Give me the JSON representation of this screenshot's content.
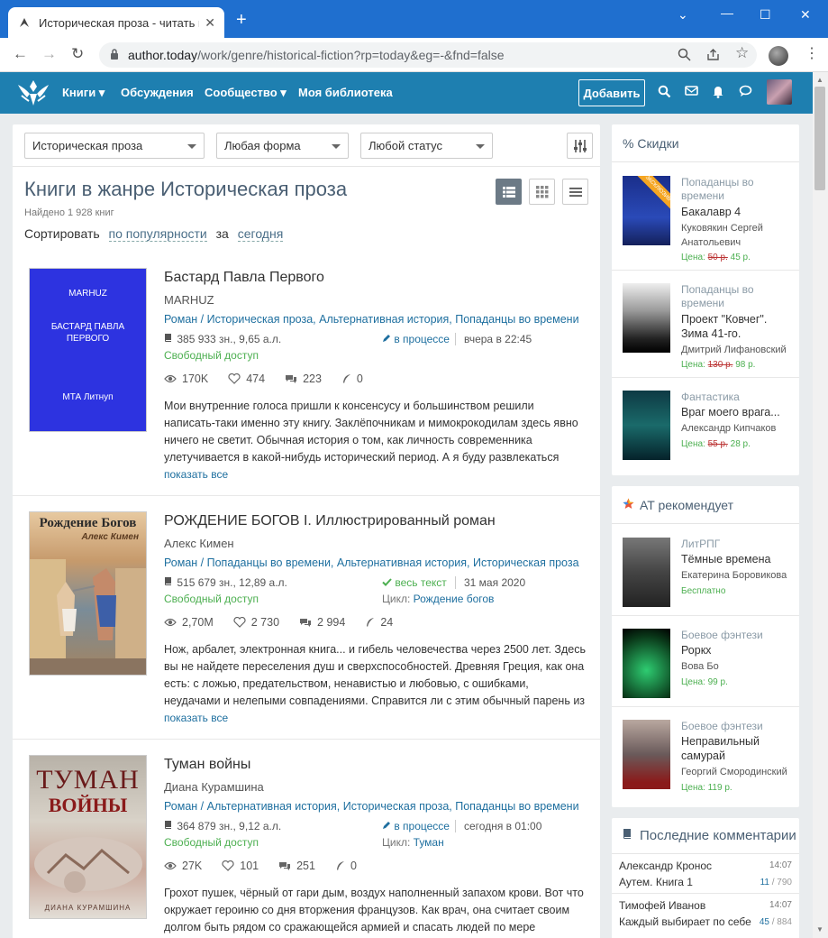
{
  "browser": {
    "tab_title": "Историческая проза - читать книг",
    "url_host": "author.today",
    "url_path": "/work/genre/historical-fiction?rp=today&eg=-&fnd=false"
  },
  "header": {
    "nav": [
      "Книги",
      "Обсуждения",
      "Сообщество",
      "Моя библиотека"
    ],
    "add_button": "Добавить"
  },
  "filters": {
    "genre": "Историческая проза",
    "form": "Любая форма",
    "status": "Любой статус"
  },
  "page": {
    "title": "Книги в жанре Историческая проза",
    "found": "Найдено 1 928 книг",
    "sort_label": "Сортировать",
    "sort_value": "по популярности",
    "sort_for": "за",
    "sort_period": "сегодня"
  },
  "books": [
    {
      "title": "Бастард Павла Первого",
      "author": "MARHUZ",
      "genres": "Роман / Историческая проза, Альтернативная история, Попаданцы во времени",
      "size": "385 933 зн., 9,65 а.л.",
      "status": "в процессе",
      "date": "вчера в 22:45",
      "access": "Свободный доступ",
      "cycle_label": "",
      "cycle": "",
      "views": "170K",
      "likes": "474",
      "comments": "223",
      "rewards": "0",
      "description": "Мои внутренние голоса пришли к консенсусу и большинством решили написать-таки именно эту книгу. Заклёпочникам и мимокрокодилам здесь явно ничего не светит. Обычная история о том, как личность современника улетучивается в какой-нибудь исторический период. А я буду развлекаться",
      "more": "показать все",
      "cover_lines": [
        "MARHUZ",
        "БАСТАРД ПАВЛА ПЕРВОГО",
        "МТА Литнуп"
      ]
    },
    {
      "title": "РОЖДЕНИЕ БОГОВ I. Иллюстрированный роман",
      "author": "Алекс Кимен",
      "genres": "Роман / Попаданцы во времени, Альтернативная история, Историческая проза",
      "size": "515 679 зн., 12,89 а.л.",
      "status": "весь текст",
      "date": "31 мая 2020",
      "access": "Свободный доступ",
      "cycle_label": "Цикл:",
      "cycle": "Рождение богов",
      "views": "2,70M",
      "likes": "2 730",
      "comments": "2 994",
      "rewards": "24",
      "description": "Нож, арбалет, электронная книга... и гибель человечества через 2500 лет. Здесь вы не найдете переселения душ и сверхспособностей. Древняя Греция, как она есть: с ложью, предательством, ненавистью и любовью, с ошибками, неудачами и нелепыми совпадениями. Справится ли с этим обычный парень из",
      "more": "показать все",
      "cover_lines": [
        "Рождение Богов",
        "Алекс Кимен"
      ]
    },
    {
      "title": "Туман войны",
      "author": "Диана Курамшина",
      "genres": "Роман / Альтернативная история, Историческая проза, Попаданцы во времени",
      "size": "364 879 зн., 9,12 а.л.",
      "status": "в процессе",
      "date": "сегодня в 01:00",
      "access": "Свободный доступ",
      "cycle_label": "Цикл:",
      "cycle": "Туман",
      "views": "27K",
      "likes": "101",
      "comments": "251",
      "rewards": "0",
      "description": "Грохот пушек, чёрный от гари дым, воздух наполненный запахом крови. Вот что окружает героиню со дня вторжения французов. Как врач, она считает своим долгом быть рядом со сражающейся армией и спасать людей по мере",
      "more": "показать все",
      "cover_lines": [
        "ТУМАН",
        "ВОЙНЫ",
        "ДИАНА КУРАМШИНА"
      ]
    }
  ],
  "discounts": {
    "title": "% Скидки",
    "price_label": "Цена:",
    "items": [
      {
        "genre": "Попаданцы во времени",
        "title": "Бакалавр 4",
        "author": "Куковякин Сергей Анатольевич",
        "old_price": "50 р.",
        "new_price": "45 р.",
        "badge": "ЭКСКЛЮЗИВ"
      },
      {
        "genre": "Попаданцы во времени",
        "title": "Проект \"Ковчег\". Зима 41-го.",
        "author": "Дмитрий Лифановский",
        "old_price": "130 р.",
        "new_price": "98 р."
      },
      {
        "genre": "Фантастика",
        "title": "Враг моего врага...",
        "author": "Александр Кипчаков",
        "old_price": "55 р.",
        "new_price": "28 р."
      }
    ]
  },
  "recommend": {
    "title": "AT рекомендует",
    "price_label": "Цена:",
    "items": [
      {
        "genre": "ЛитРПГ",
        "title": "Тёмные времена",
        "author": "Екатерина Боровикова",
        "price": "Бесплатно"
      },
      {
        "genre": "Боевое фэнтези",
        "title": "Роркх",
        "author": "Вова Бо",
        "price": "99 р."
      },
      {
        "genre": "Боевое фэнтези",
        "title": "Неправильный самурай",
        "author": "Георгий Смородинский",
        "price": "119 р."
      }
    ]
  },
  "comments": {
    "title": "Последние комментарии",
    "items": [
      {
        "user": "Александр Кронос",
        "time": "14:07",
        "book": "Аутем. Книга 1",
        "count": "11",
        "total": "/ 790"
      },
      {
        "user": "Тимофей Иванов",
        "time": "14:07",
        "book": "Каждый выбирает по себе",
        "count": "45",
        "total": "/ 884"
      }
    ]
  },
  "colors": {
    "header": "#1e7fb0",
    "link": "#1e6f9f",
    "green": "#4caf50",
    "chrome": "#1f6fcf"
  }
}
